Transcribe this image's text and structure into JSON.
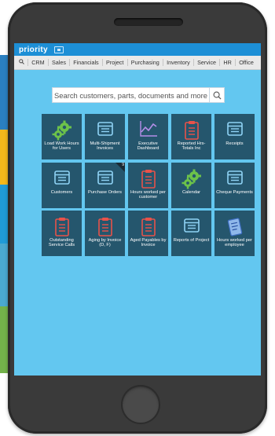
{
  "app": {
    "logo": "priority"
  },
  "menu": {
    "items": [
      "CRM",
      "Sales",
      "Financials",
      "Project",
      "Purchasing",
      "Inventory",
      "Service",
      "HR",
      "Office"
    ]
  },
  "search": {
    "placeholder": "Search customers, parts, documents and more"
  },
  "tiles": [
    {
      "label": "Load Work Hours for Users",
      "icon": "gears-icon"
    },
    {
      "label": "Multi-Shipment Invoices",
      "icon": "form-icon"
    },
    {
      "label": "Executive Dashboard",
      "icon": "chart-icon"
    },
    {
      "label": "Reported Hrs-Totals Inc",
      "icon": "clipboard-icon"
    },
    {
      "label": "Receipts",
      "icon": "form-icon"
    },
    {
      "label": "Customers",
      "icon": "form-icon"
    },
    {
      "label": "Purchase Orders",
      "icon": "form-icon",
      "badge": "9"
    },
    {
      "label": "Hours worked per customer",
      "icon": "clipboard-icon"
    },
    {
      "label": "Calendar",
      "icon": "gears-icon"
    },
    {
      "label": "Cheque Payments",
      "icon": "form-icon"
    },
    {
      "label": "Outstanding Service Calls",
      "icon": "clipboard-icon"
    },
    {
      "label": "Aging by Invoice (D, F)",
      "icon": "clipboard-icon"
    },
    {
      "label": "Aged Payables by Invoice",
      "icon": "clipboard-icon"
    },
    {
      "label": "Reports of Project",
      "icon": "form-icon"
    },
    {
      "label": "Hours worked per employee",
      "icon": "report-icon"
    }
  ],
  "colors": {
    "screen_bg": "#63c7f0",
    "topbar": "#1d8fd6",
    "tile_bg": "#25566d",
    "icon_green": "#6cc24a",
    "icon_red": "#e8524a",
    "icon_blue": "#8fd3f5",
    "icon_purple": "#b48ee8"
  }
}
